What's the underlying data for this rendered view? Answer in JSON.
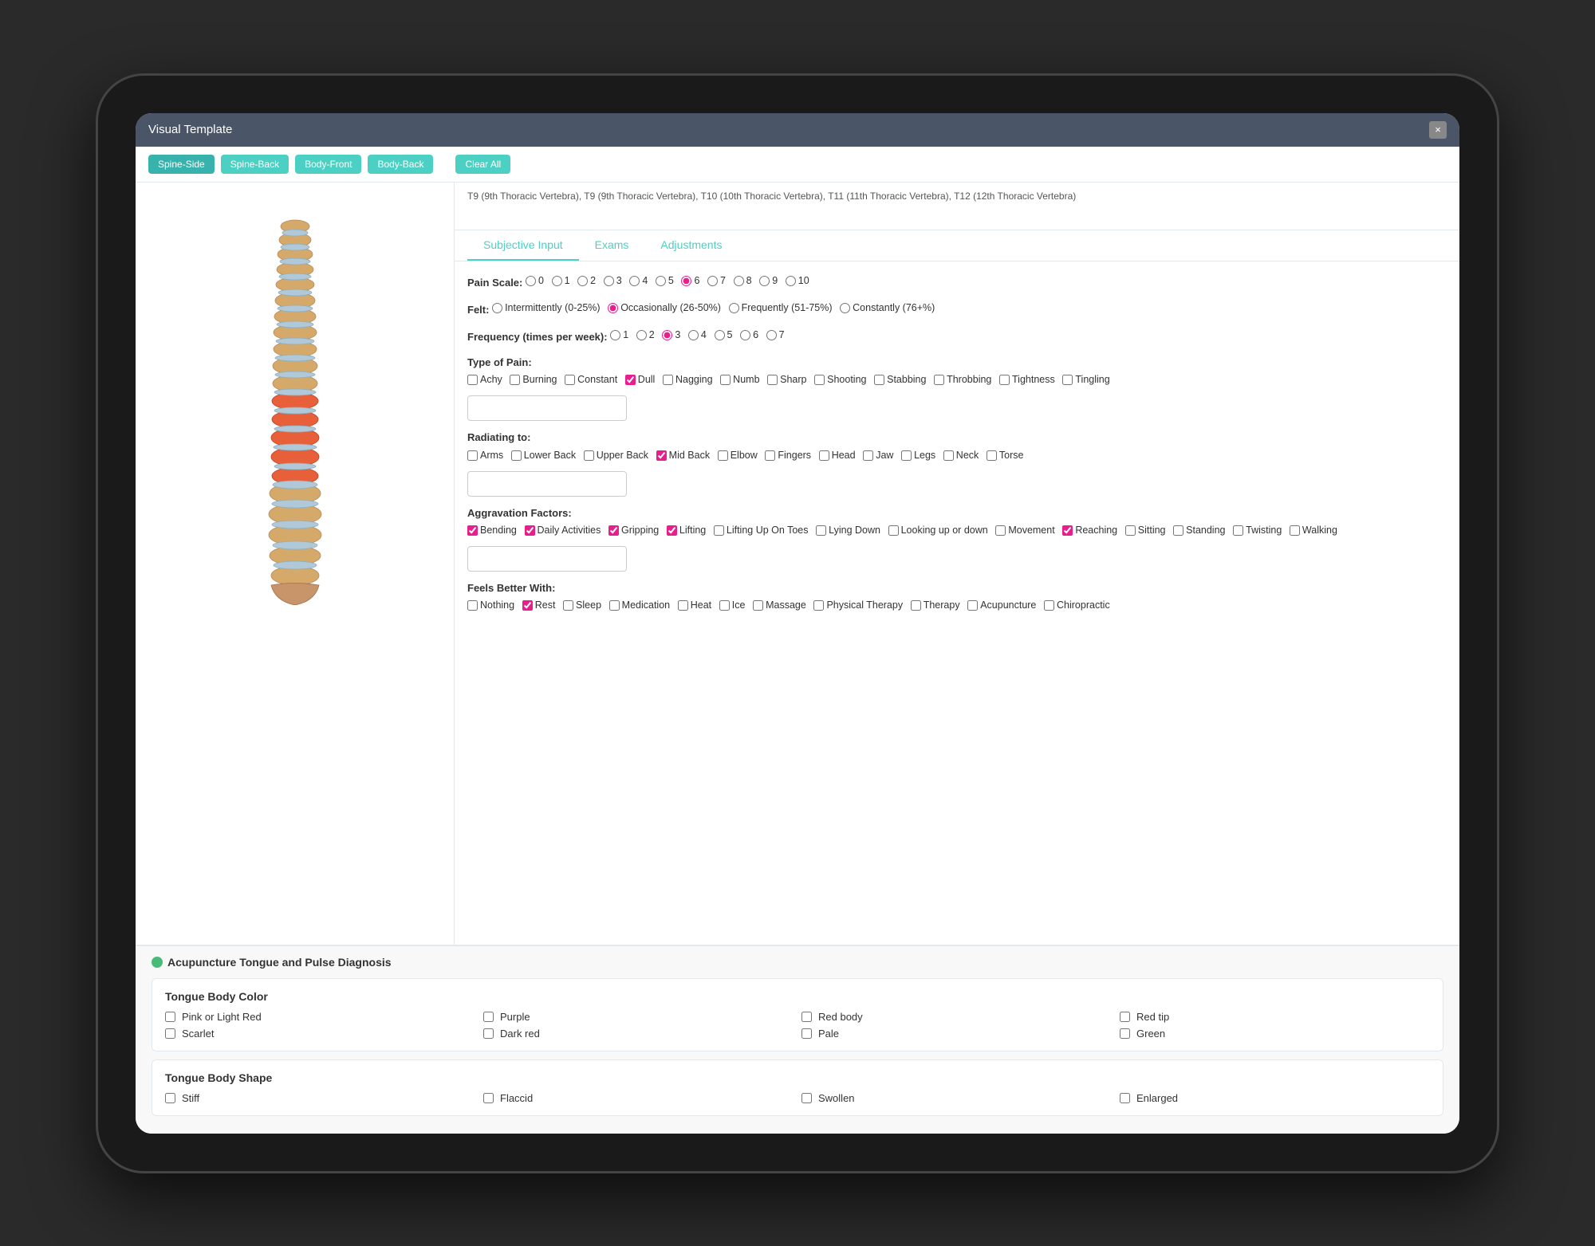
{
  "titleBar": {
    "title": "Visual Template",
    "closeLabel": "×"
  },
  "toolbar": {
    "tabs": [
      "Spine-Side",
      "Spine-Back",
      "Body-Front",
      "Body-Back"
    ],
    "clearLabel": "Clear All"
  },
  "selectedText": "T9 (9th Thoracic Vertebra), T9 (9th Thoracic Vertebra), T10 (10th Thoracic Vertebra), T11 (11th Thoracic Vertebra), T12 (12th Thoracic Vertebra)",
  "contentTabs": [
    "Subjective Input",
    "Exams",
    "Adjustments"
  ],
  "activeContentTab": "Subjective Input",
  "subjective": {
    "painScale": {
      "label": "Pain Scale:",
      "options": [
        "1",
        "2",
        "3",
        "4",
        "5",
        "6",
        "7",
        "8",
        "9",
        "10"
      ],
      "selected": "6"
    },
    "felt": {
      "label": "Felt:",
      "options": [
        "Intermittently (0-25%)",
        "Occasionally (26-50%)",
        "Frequently (51-75%)",
        "Constantly (76+%)"
      ],
      "selected": "Occasionally (26-50%)"
    },
    "frequency": {
      "label": "Frequency (times per week):",
      "options": [
        "1",
        "2",
        "3",
        "4",
        "5",
        "6",
        "7"
      ],
      "selected": "3"
    },
    "typeOfPain": {
      "label": "Type of Pain:",
      "options": [
        "Achy",
        "Burning",
        "Constant",
        "Dull",
        "Nagging",
        "Numb",
        "Sharp",
        "Shooting",
        "Stabbing",
        "Throbbing",
        "Tightness",
        "Tingling"
      ],
      "checked": [
        "Dull"
      ]
    },
    "radiatingTo": {
      "label": "Radiating to:",
      "options": [
        "Arms",
        "Lower Back",
        "Upper Back",
        "Mid Back",
        "Elbow",
        "Fingers",
        "Head",
        "Jaw",
        "Legs",
        "Neck",
        "Torse"
      ],
      "checked": [
        "Mid Back"
      ]
    },
    "aggravationFactors": {
      "label": "Aggravation Factors:",
      "options": [
        "Bending",
        "Daily Activities",
        "Gripping",
        "Lifting",
        "Lifting Up On Toes",
        "Lying Down",
        "Looking up or down",
        "Movement",
        "Reaching",
        "Sitting",
        "Standing",
        "Twisting",
        "Walking"
      ],
      "checked": [
        "Bending",
        "Daily Activities",
        "Gripping",
        "Lifting",
        "Reaching"
      ]
    },
    "feelsBetterWith": {
      "label": "Feels Better With:",
      "options": [
        "Nothing",
        "Rest",
        "Sleep",
        "Medication",
        "Heat",
        "Ice",
        "Massage",
        "Physical Therapy",
        "Therapy",
        "Acupuncture",
        "Chiropractic"
      ],
      "checked": [
        "Rest"
      ]
    }
  },
  "acupuncture": {
    "sectionTitle": "Acupuncture Tongue and Pulse Diagnosis",
    "tongueBodyColor": {
      "title": "Tongue Body Color",
      "options": [
        "Pink or Light Red",
        "Purple",
        "Red body",
        "Red tip",
        "Scarlet",
        "Dark red",
        "Pale",
        "Green"
      ],
      "checked": []
    },
    "tongueBodyShape": {
      "title": "Tongue Body Shape",
      "options": [
        "Stiff",
        "Flaccid",
        "Swollen",
        "Enlarged"
      ],
      "checked": []
    }
  }
}
